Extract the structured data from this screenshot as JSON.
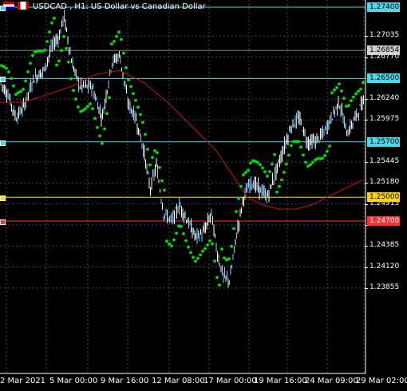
{
  "window": {
    "title": "USDCAD , H1:  US Dollar vs Canadian Dollar"
  },
  "colors": {
    "background": "#000000",
    "grid": "#3a4a5a",
    "candles": "#ffffff",
    "candles_up": "#87cefa",
    "sar": "#00e000",
    "ma": "#d01010",
    "cyan_line": "#4fd6e8",
    "yellow_line": "#ffd700",
    "red_line": "#ff3030",
    "current_price_label": "#d0d0d0"
  },
  "price_axis": {
    "ticks": [
      "1.27035",
      "1.26770",
      "1.26240",
      "1.25975",
      "1.25445",
      "1.25180",
      "1.24915",
      "1.24650",
      "1.24385",
      "1.24120",
      "1.23855"
    ]
  },
  "time_axis": {
    "labels": [
      "2 Mar 2021",
      "5 Mar 00:00",
      "9 Mar 16:00",
      "12 Mar 08:00",
      "17 Mar 00:00",
      "19 Mar 16:00",
      "24 Mar 09:00",
      "29 Mar 02:00"
    ]
  },
  "levels": [
    {
      "price": "1.27400",
      "color": "#4fd6e8",
      "text_color": "#000"
    },
    {
      "price": "1.26500",
      "color": "#4fd6e8",
      "text_color": "#000"
    },
    {
      "price": "1.25700",
      "color": "#4fd6e8",
      "text_color": "#000"
    },
    {
      "price": "1.25000",
      "color": "#ffd700",
      "text_color": "#000"
    },
    {
      "price": "1.24700",
      "color": "#ff3030",
      "text_color": "#fff"
    }
  ],
  "current_price": "1.26854",
  "chart_data": {
    "type": "line",
    "title": "USDCAD , H1:  US Dollar vs Canadian Dollar",
    "series": [
      {
        "name": "USDCAD",
        "x": [
          "2 Mar 2021",
          "5 Mar 00:00",
          "9 Mar 16:00",
          "12 Mar 08:00",
          "17 Mar 00:00",
          "19 Mar 16:00",
          "24 Mar 09:00",
          "29 Mar 02:00"
        ],
        "values": [
          1.2645,
          1.27,
          1.263,
          1.248,
          1.239,
          1.253,
          1.259,
          1.262
        ]
      }
    ],
    "ylim": [
      1.238,
      1.2745
    ]
  }
}
